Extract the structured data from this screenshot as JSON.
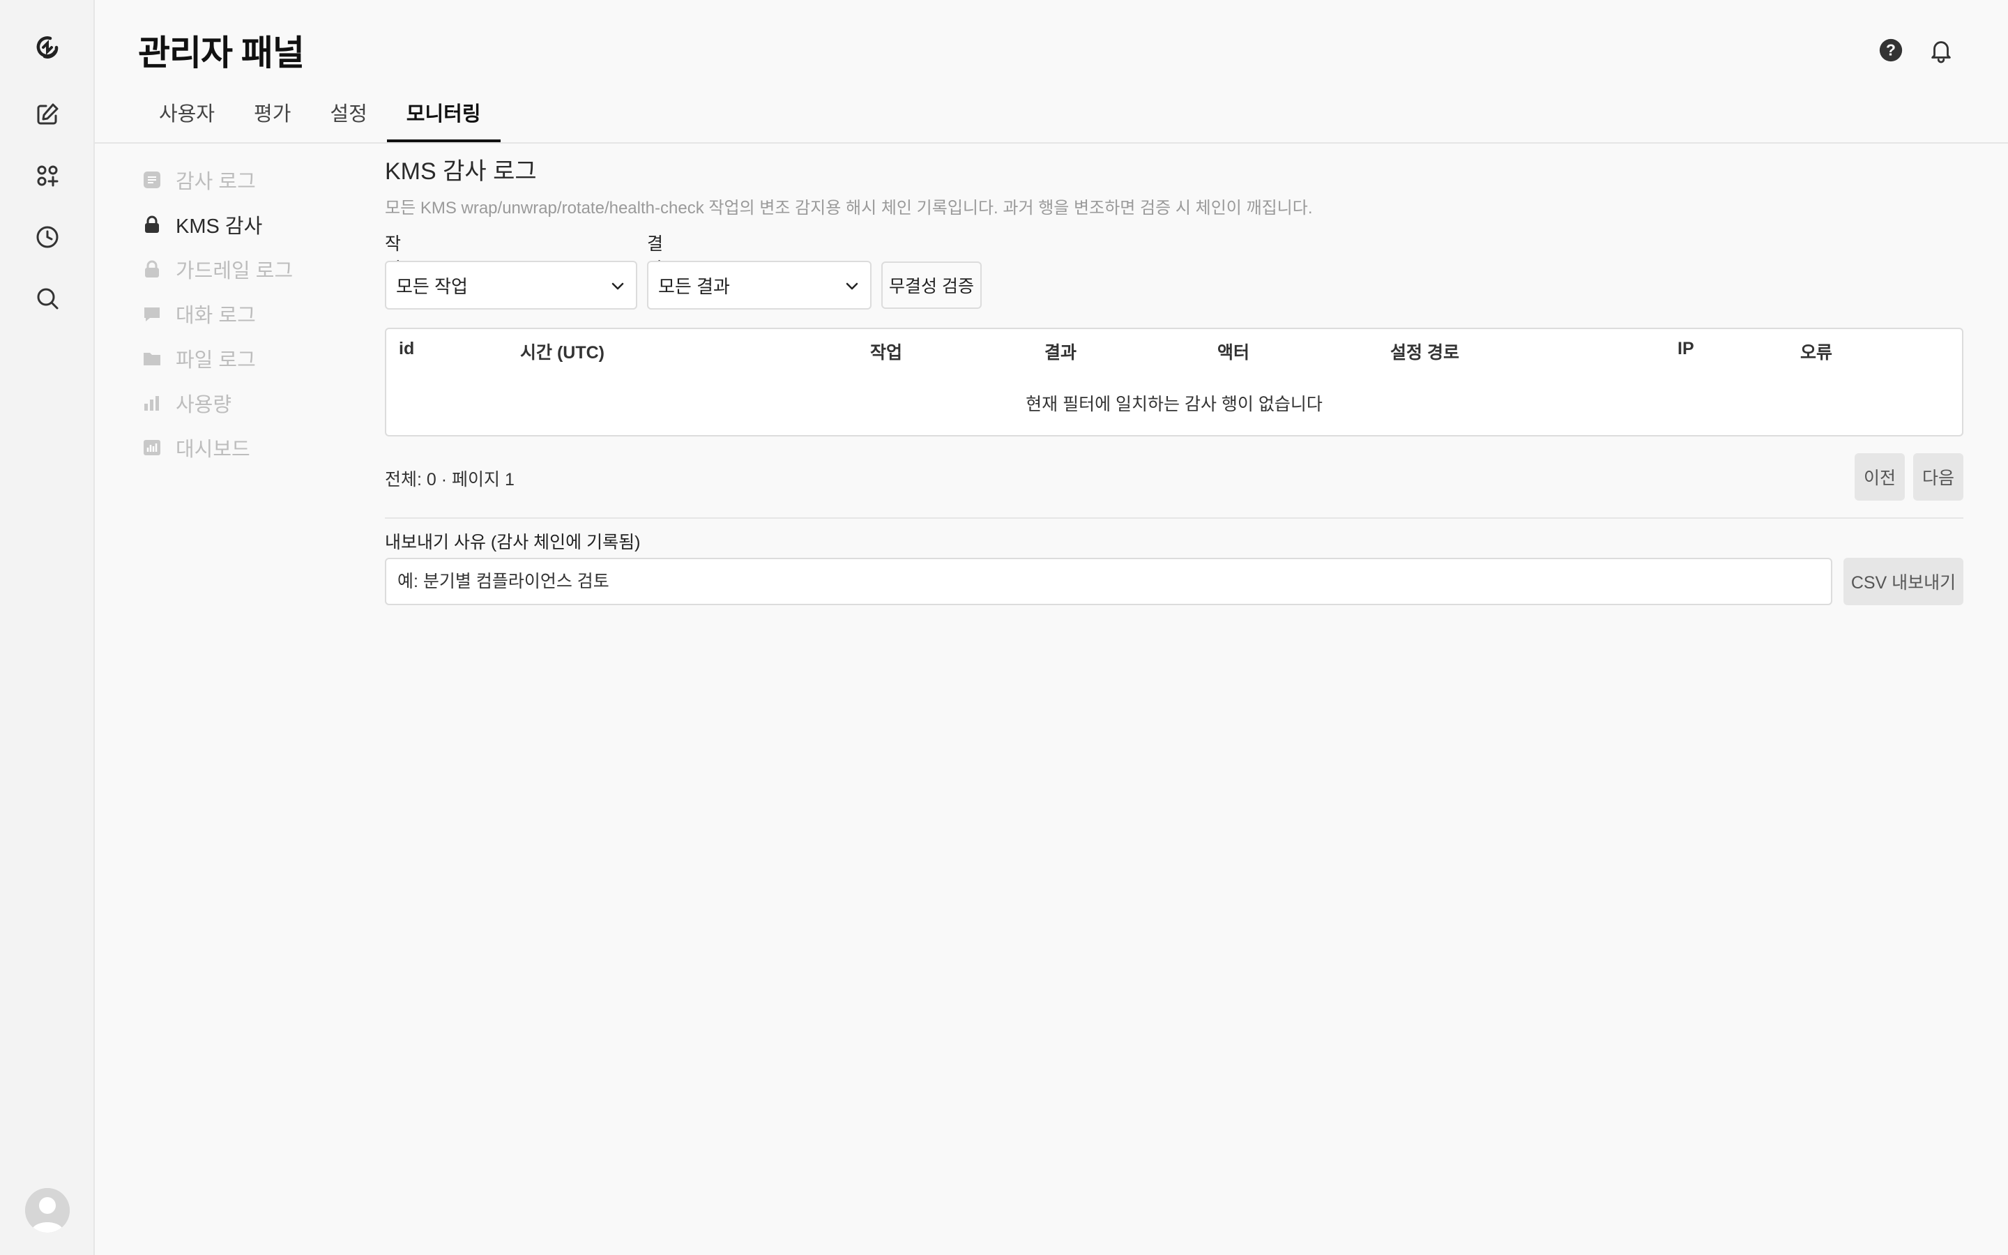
{
  "header": {
    "title": "관리자 패널",
    "help_icon": "help-circle-icon",
    "notifications_icon": "bell-icon"
  },
  "rail": {
    "icons": [
      "logo-icon",
      "new-chat-icon",
      "workspace-icon",
      "history-icon",
      "search-icon"
    ],
    "avatar_icon": "user-avatar-icon"
  },
  "tabs": [
    {
      "label": "사용자",
      "active": false
    },
    {
      "label": "평가",
      "active": false
    },
    {
      "label": "설정",
      "active": false
    },
    {
      "label": "모니터링",
      "active": true
    }
  ],
  "subnav": [
    {
      "label": "감사 로그",
      "icon": "document-icon",
      "active": false
    },
    {
      "label": "KMS 감사",
      "icon": "lock-icon",
      "active": true
    },
    {
      "label": "가드레일 로그",
      "icon": "lock-icon",
      "active": false
    },
    {
      "label": "대화 로그",
      "icon": "chat-bubble-icon",
      "active": false
    },
    {
      "label": "파일 로그",
      "icon": "folder-icon",
      "active": false
    },
    {
      "label": "사용량",
      "icon": "bar-chart-icon",
      "active": false
    },
    {
      "label": "대시보드",
      "icon": "dashboard-icon",
      "active": false
    }
  ],
  "main": {
    "title": "KMS 감사 로그",
    "description": "모든 KMS wrap/unwrap/rotate/health-check 작업의 변조 감지용 해시 체인 기록입니다. 과거 행을 변조하면 검증 시 체인이 깨집니다.",
    "filters": {
      "operation_label": "작업",
      "operation_value": "모든 작업",
      "result_label": "결과",
      "result_value": "모든 결과",
      "verify_button": "무결성 검증"
    },
    "table": {
      "columns": [
        "id",
        "시간 (UTC)",
        "작업",
        "결과",
        "액터",
        "설정 경로",
        "IP",
        "오류"
      ],
      "empty_message": "현재 필터에 일치하는 감사 행이 없습니다",
      "rows": []
    },
    "pagination": {
      "summary": "전체: 0 · 페이지 1",
      "prev_button": "이전",
      "next_button": "다음"
    },
    "export": {
      "label": "내보내기 사유 (감사 체인에 기록됨)",
      "placeholder": "예: 분기별 컴플라이언스 검토",
      "button": "CSV 내보내기"
    }
  }
}
